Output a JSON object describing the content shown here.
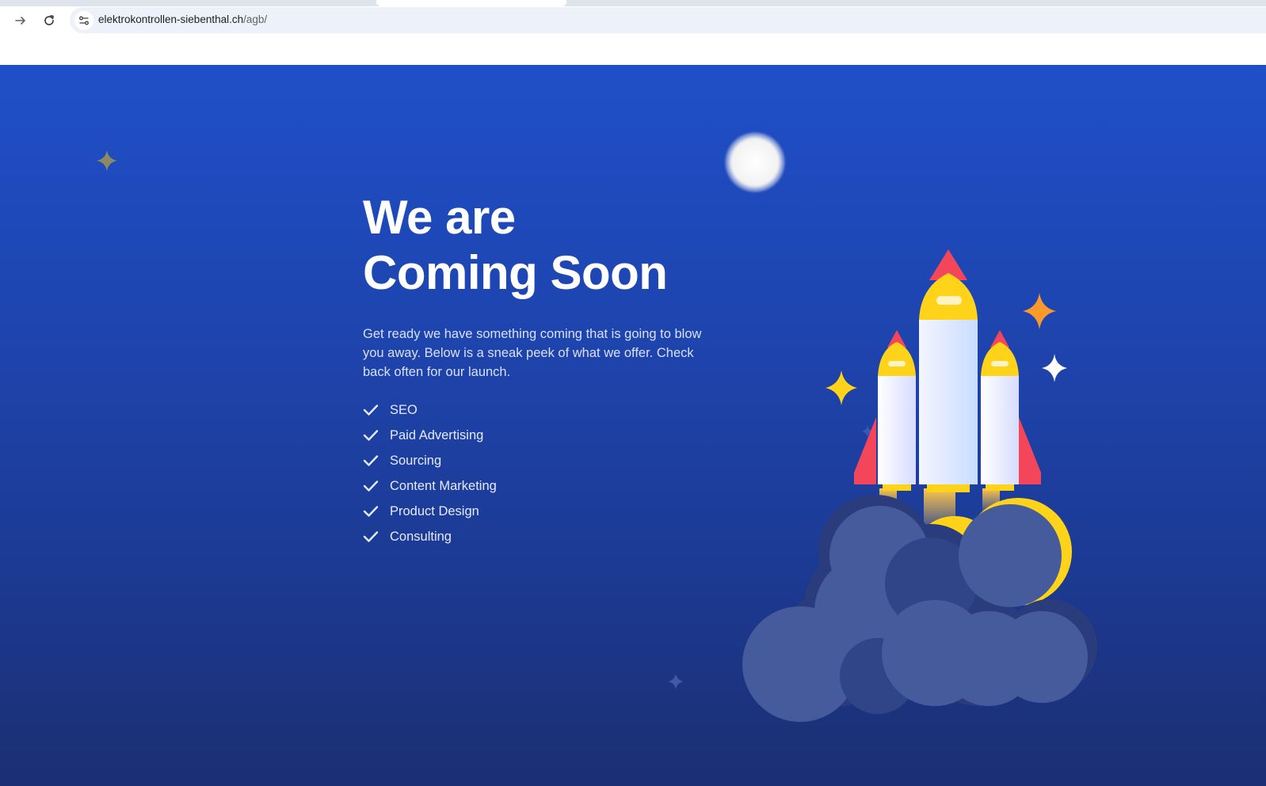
{
  "browser": {
    "url_host": "elektrokontrollen-siebenthal.ch",
    "url_path": "/agb/",
    "icons": {
      "forward": "arrow-forward-icon",
      "reload": "reload-icon",
      "site_info": "tune-icon"
    }
  },
  "hero": {
    "title_line1": "We are",
    "title_line2": "Coming Soon",
    "intro": "Get ready we have something coming that is going to blow you away. Below is a sneak peek of what we offer. Check back often for our launch.",
    "features": [
      "SEO",
      "Paid Advertising",
      "Sourcing",
      "Content Marketing",
      "Product Design",
      "Consulting"
    ]
  },
  "colors": {
    "background_top": "#1f4fc8",
    "background_bottom": "#1b2f72",
    "rocket_red": "#f4465b",
    "rocket_yellow": "#ffd319",
    "cloud": "#455b9c",
    "cloud_dark": "#2a3c7c"
  }
}
